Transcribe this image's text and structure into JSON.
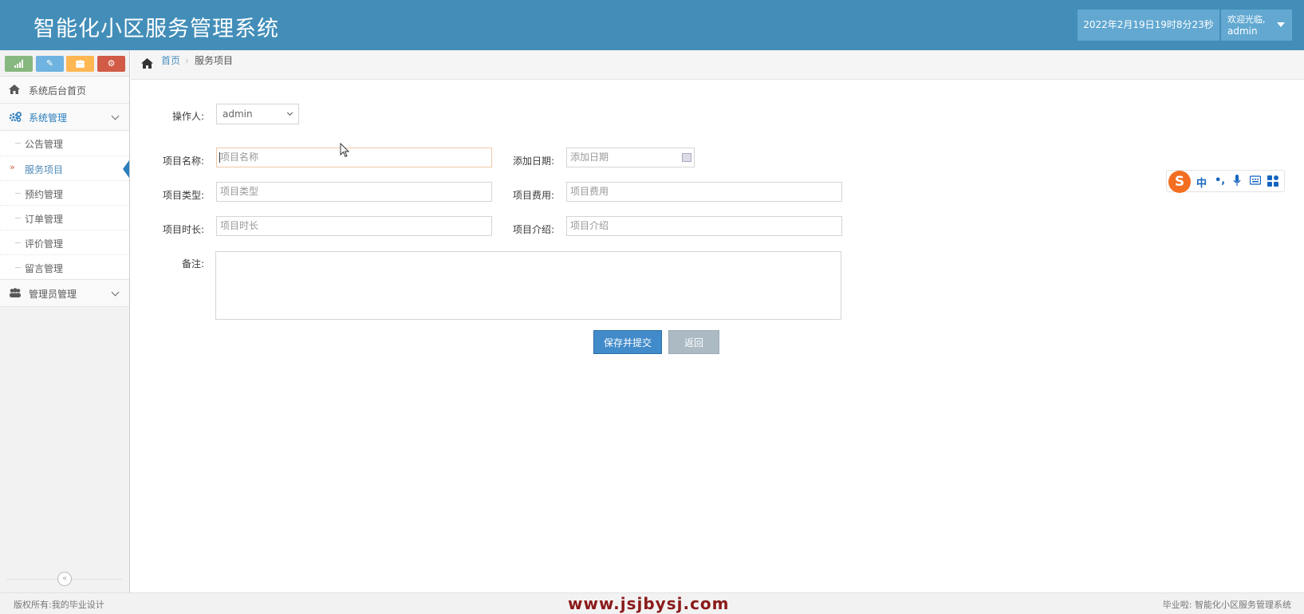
{
  "header": {
    "title": "智能化小区服务管理系统",
    "datetime": "2022年2月19日19时8分23秒",
    "welcome": "欢迎光临,",
    "username": "admin"
  },
  "sidebar": {
    "shortcuts": [
      "signal-icon",
      "pencil-icon",
      "users-icon",
      "cogs-icon"
    ],
    "home": "系统后台首页",
    "system_menu": "系统管理",
    "system_items": [
      "公告管理",
      "服务项目",
      "预约管理",
      "订单管理",
      "评价管理",
      "留言管理"
    ],
    "active_item": "服务项目",
    "admin_menu": "管理员管理"
  },
  "breadcrumb": {
    "home": "首页",
    "current": "服务项目"
  },
  "form": {
    "operator_label": "操作人:",
    "operator_value": "admin",
    "name_label": "项目名称:",
    "name_placeholder": "项目名称",
    "date_label": "添加日期:",
    "date_placeholder": "添加日期",
    "type_label": "项目类型:",
    "type_placeholder": "项目类型",
    "fee_label": "项目费用:",
    "fee_placeholder": "项目费用",
    "duration_label": "项目时长:",
    "duration_placeholder": "项目时长",
    "intro_label": "项目介绍:",
    "intro_placeholder": "项目介绍",
    "remark_label": "备注:",
    "save_button": "保存并提交",
    "back_button": "返回"
  },
  "ime": {
    "mode": "中",
    "punct": "•,",
    "logo": "S"
  },
  "footer": {
    "copyright": "版权所有:我的毕业设计",
    "watermark": "www.jsjbysj.com",
    "right": "毕业啦: 智能化小区服务管理系统"
  },
  "colors": {
    "header": "#438eb9",
    "primary": "#428bca",
    "active": "#2b7dbc"
  }
}
